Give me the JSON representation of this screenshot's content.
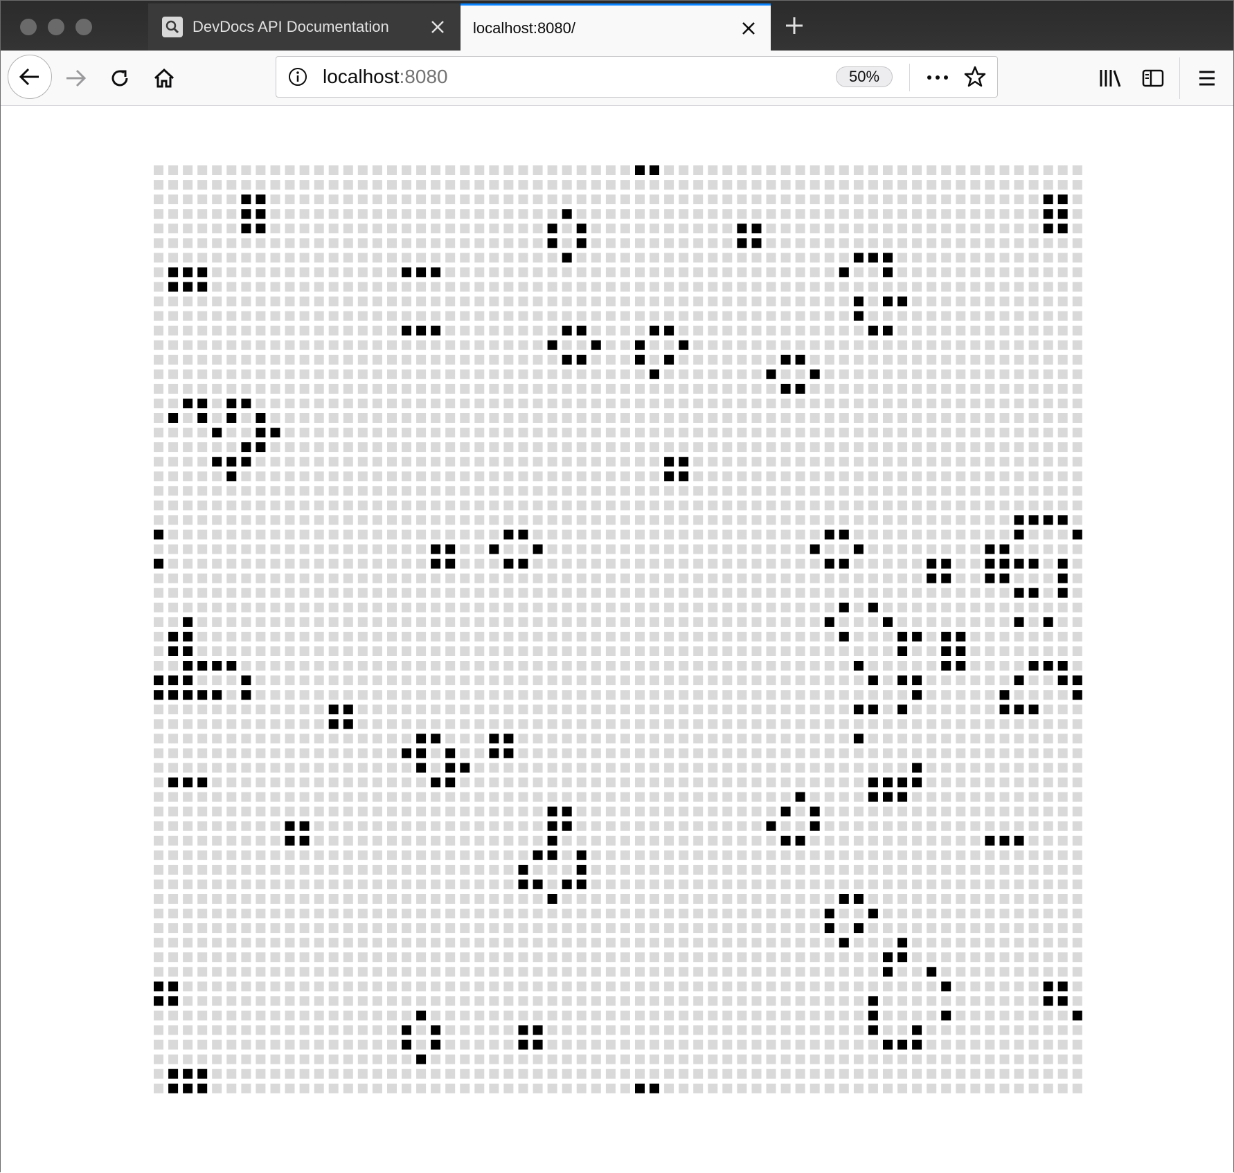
{
  "window": {
    "traffic_lights": [
      "close",
      "minimize",
      "zoom"
    ]
  },
  "tabs": [
    {
      "title": "DevDocs API Documentation",
      "icon": "search-icon",
      "active": false
    },
    {
      "title": "localhost:8080/",
      "icon": "",
      "active": true
    }
  ],
  "toolbar": {
    "url_host": "localhost",
    "url_port": ":8080",
    "zoom_label": "50%",
    "icons": [
      "back-arrow-icon",
      "forward-arrow-icon",
      "reload-icon",
      "home-icon",
      "info-icon",
      "page-actions-icon",
      "bookmark-star-icon",
      "library-icon",
      "sidebar-icon",
      "menu-icon"
    ]
  },
  "board": {
    "rows": 64,
    "cols": 64,
    "live_color": "#000000",
    "dead_color": "#d9d9d9",
    "live_cells": [
      [
        0,
        33
      ],
      [
        0,
        34
      ],
      [
        2,
        6
      ],
      [
        2,
        7
      ],
      [
        2,
        61
      ],
      [
        2,
        62
      ],
      [
        3,
        6
      ],
      [
        3,
        7
      ],
      [
        3,
        61
      ],
      [
        3,
        62
      ],
      [
        4,
        6
      ],
      [
        4,
        7
      ],
      [
        4,
        61
      ],
      [
        4,
        62
      ],
      [
        3,
        28
      ],
      [
        4,
        27
      ],
      [
        4,
        29
      ],
      [
        5,
        27
      ],
      [
        5,
        29
      ],
      [
        6,
        28
      ],
      [
        4,
        40
      ],
      [
        4,
        41
      ],
      [
        5,
        40
      ],
      [
        5,
        41
      ],
      [
        6,
        48
      ],
      [
        6,
        49
      ],
      [
        6,
        50
      ],
      [
        7,
        47
      ],
      [
        7,
        50
      ],
      [
        9,
        48
      ],
      [
        9,
        50
      ],
      [
        9,
        51
      ],
      [
        10,
        48
      ],
      [
        11,
        49
      ],
      [
        11,
        50
      ],
      [
        7,
        1
      ],
      [
        7,
        2
      ],
      [
        7,
        3
      ],
      [
        8,
        1
      ],
      [
        8,
        2
      ],
      [
        8,
        3
      ],
      [
        7,
        17
      ],
      [
        7,
        18
      ],
      [
        7,
        19
      ],
      [
        11,
        17
      ],
      [
        11,
        18
      ],
      [
        11,
        19
      ],
      [
        11,
        28
      ],
      [
        11,
        29
      ],
      [
        12,
        27
      ],
      [
        12,
        30
      ],
      [
        13,
        28
      ],
      [
        13,
        29
      ],
      [
        11,
        34
      ],
      [
        11,
        35
      ],
      [
        12,
        33
      ],
      [
        12,
        36
      ],
      [
        13,
        33
      ],
      [
        13,
        35
      ],
      [
        14,
        34
      ],
      [
        13,
        43
      ],
      [
        13,
        44
      ],
      [
        14,
        42
      ],
      [
        14,
        45
      ],
      [
        15,
        43
      ],
      [
        15,
        44
      ],
      [
        16,
        2
      ],
      [
        16,
        3
      ],
      [
        16,
        5
      ],
      [
        16,
        6
      ],
      [
        17,
        1
      ],
      [
        17,
        3
      ],
      [
        17,
        5
      ],
      [
        17,
        7
      ],
      [
        18,
        4
      ],
      [
        18,
        7
      ],
      [
        18,
        8
      ],
      [
        19,
        6
      ],
      [
        19,
        7
      ],
      [
        20,
        4
      ],
      [
        20,
        5
      ],
      [
        20,
        6
      ],
      [
        21,
        5
      ],
      [
        20,
        35
      ],
      [
        20,
        36
      ],
      [
        21,
        35
      ],
      [
        21,
        36
      ],
      [
        24,
        59
      ],
      [
        24,
        60
      ],
      [
        24,
        61
      ],
      [
        24,
        62
      ],
      [
        25,
        59
      ],
      [
        25,
        63
      ],
      [
        26,
        57
      ],
      [
        26,
        58
      ],
      [
        27,
        57
      ],
      [
        27,
        58
      ],
      [
        27,
        59
      ],
      [
        27,
        60
      ],
      [
        27,
        62
      ],
      [
        28,
        57
      ],
      [
        28,
        58
      ],
      [
        28,
        62
      ],
      [
        29,
        59
      ],
      [
        29,
        60
      ],
      [
        29,
        62
      ],
      [
        31,
        59
      ],
      [
        31,
        61
      ],
      [
        25,
        0
      ],
      [
        27,
        0
      ],
      [
        25,
        24
      ],
      [
        25,
        25
      ],
      [
        26,
        23
      ],
      [
        26,
        26
      ],
      [
        27,
        24
      ],
      [
        27,
        25
      ],
      [
        26,
        19
      ],
      [
        26,
        20
      ],
      [
        27,
        19
      ],
      [
        27,
        20
      ],
      [
        25,
        46
      ],
      [
        25,
        47
      ],
      [
        26,
        45
      ],
      [
        26,
        48
      ],
      [
        27,
        46
      ],
      [
        27,
        47
      ],
      [
        27,
        53
      ],
      [
        27,
        54
      ],
      [
        28,
        53
      ],
      [
        28,
        54
      ],
      [
        30,
        47
      ],
      [
        30,
        49
      ],
      [
        31,
        46
      ],
      [
        31,
        50
      ],
      [
        32,
        47
      ],
      [
        32,
        51
      ],
      [
        32,
        52
      ],
      [
        32,
        54
      ],
      [
        32,
        55
      ],
      [
        33,
        51
      ],
      [
        33,
        54
      ],
      [
        33,
        55
      ],
      [
        34,
        48
      ],
      [
        34,
        54
      ],
      [
        34,
        55
      ],
      [
        35,
        49
      ],
      [
        35,
        51
      ],
      [
        35,
        52
      ],
      [
        36,
        52
      ],
      [
        37,
        48
      ],
      [
        37,
        49
      ],
      [
        37,
        51
      ],
      [
        39,
        48
      ],
      [
        31,
        2
      ],
      [
        32,
        1
      ],
      [
        32,
        2
      ],
      [
        33,
        1
      ],
      [
        33,
        2
      ],
      [
        34,
        2
      ],
      [
        34,
        3
      ],
      [
        34,
        4
      ],
      [
        34,
        5
      ],
      [
        35,
        0
      ],
      [
        35,
        1
      ],
      [
        35,
        2
      ],
      [
        35,
        6
      ],
      [
        36,
        0
      ],
      [
        36,
        1
      ],
      [
        36,
        2
      ],
      [
        36,
        3
      ],
      [
        36,
        4
      ],
      [
        36,
        6
      ],
      [
        34,
        60
      ],
      [
        34,
        61
      ],
      [
        34,
        62
      ],
      [
        35,
        59
      ],
      [
        35,
        62
      ],
      [
        35,
        63
      ],
      [
        36,
        58
      ],
      [
        36,
        63
      ],
      [
        37,
        58
      ],
      [
        37,
        59
      ],
      [
        37,
        60
      ],
      [
        37,
        12
      ],
      [
        37,
        13
      ],
      [
        38,
        12
      ],
      [
        38,
        13
      ],
      [
        39,
        18
      ],
      [
        39,
        19
      ],
      [
        40,
        17
      ],
      [
        40,
        18
      ],
      [
        40,
        20
      ],
      [
        41,
        18
      ],
      [
        41,
        20
      ],
      [
        41,
        21
      ],
      [
        42,
        19
      ],
      [
        42,
        20
      ],
      [
        39,
        23
      ],
      [
        39,
        24
      ],
      [
        40,
        23
      ],
      [
        40,
        24
      ],
      [
        42,
        1
      ],
      [
        42,
        2
      ],
      [
        42,
        3
      ],
      [
        41,
        52
      ],
      [
        42,
        49
      ],
      [
        42,
        50
      ],
      [
        42,
        51
      ],
      [
        42,
        52
      ],
      [
        43,
        49
      ],
      [
        43,
        50
      ],
      [
        43,
        51
      ],
      [
        43,
        44
      ],
      [
        44,
        43
      ],
      [
        44,
        45
      ],
      [
        45,
        42
      ],
      [
        45,
        45
      ],
      [
        46,
        43
      ],
      [
        46,
        44
      ],
      [
        44,
        27
      ],
      [
        44,
        28
      ],
      [
        45,
        27
      ],
      [
        45,
        28
      ],
      [
        46,
        27
      ],
      [
        47,
        26
      ],
      [
        47,
        27
      ],
      [
        47,
        29
      ],
      [
        48,
        25
      ],
      [
        48,
        29
      ],
      [
        49,
        25
      ],
      [
        49,
        26
      ],
      [
        49,
        28
      ],
      [
        49,
        29
      ],
      [
        50,
        27
      ],
      [
        45,
        9
      ],
      [
        45,
        10
      ],
      [
        46,
        9
      ],
      [
        46,
        10
      ],
      [
        46,
        57
      ],
      [
        46,
        58
      ],
      [
        46,
        59
      ],
      [
        50,
        47
      ],
      [
        50,
        48
      ],
      [
        51,
        46
      ],
      [
        51,
        49
      ],
      [
        52,
        46
      ],
      [
        52,
        48
      ],
      [
        53,
        47
      ],
      [
        53,
        51
      ],
      [
        54,
        50
      ],
      [
        54,
        51
      ],
      [
        55,
        50
      ],
      [
        55,
        53
      ],
      [
        56,
        54
      ],
      [
        57,
        49
      ],
      [
        58,
        49
      ],
      [
        58,
        54
      ],
      [
        59,
        49
      ],
      [
        59,
        52
      ],
      [
        60,
        50
      ],
      [
        60,
        51
      ],
      [
        60,
        52
      ],
      [
        56,
        0
      ],
      [
        56,
        1
      ],
      [
        57,
        0
      ],
      [
        57,
        1
      ],
      [
        56,
        61
      ],
      [
        56,
        62
      ],
      [
        57,
        61
      ],
      [
        57,
        62
      ],
      [
        58,
        63
      ],
      [
        58,
        18
      ],
      [
        59,
        17
      ],
      [
        59,
        19
      ],
      [
        60,
        17
      ],
      [
        60,
        19
      ],
      [
        61,
        18
      ],
      [
        59,
        25
      ],
      [
        59,
        26
      ],
      [
        60,
        25
      ],
      [
        60,
        26
      ],
      [
        62,
        1
      ],
      [
        62,
        2
      ],
      [
        62,
        3
      ],
      [
        63,
        1
      ],
      [
        63,
        2
      ],
      [
        63,
        3
      ],
      [
        63,
        33
      ],
      [
        63,
        34
      ]
    ]
  }
}
